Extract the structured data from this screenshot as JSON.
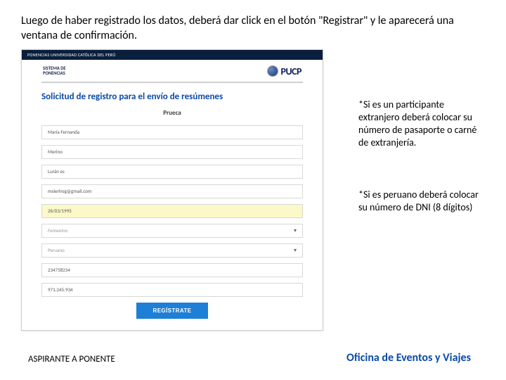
{
  "instruction": "Luego de haber registrado los datos, deberá dar click en el botón \"Registrar\" y le aparecerá una ventana de confirmación.",
  "browser_top": "PONENCIAS UNIVERSIDAD CATÓLICA DEL PERÚ",
  "app_header": {
    "sistema_line1": "SISTEMA DE",
    "sistema_line2": "PONENCIAS",
    "pucp": "PUCP"
  },
  "form": {
    "title": "Solicitud de registro para el envío de resúmenes",
    "subtitle": "Prueca",
    "fields": [
      {
        "text": "María Fernanda",
        "kind": "value",
        "highlight": false,
        "dropdown": false
      },
      {
        "text": "Merino",
        "kind": "value",
        "highlight": false,
        "dropdown": false
      },
      {
        "text": "Lurán es",
        "kind": "value",
        "highlight": false,
        "dropdown": false
      },
      {
        "text": "msierlrog@gmail.com",
        "kind": "value",
        "highlight": false,
        "dropdown": false
      },
      {
        "text": "26/03/1995",
        "kind": "value",
        "highlight": true,
        "dropdown": false
      },
      {
        "text": "Femenino",
        "kind": "placeholder",
        "highlight": false,
        "dropdown": true
      },
      {
        "text": "Peruano",
        "kind": "placeholder",
        "highlight": false,
        "dropdown": true
      },
      {
        "text": "234758234",
        "kind": "value",
        "highlight": false,
        "dropdown": false
      },
      {
        "text": "971.245.934",
        "kind": "value",
        "highlight": false,
        "dropdown": false
      }
    ],
    "submit_label": "REGÍSTRATE"
  },
  "notes": {
    "n1": "*Si es un participante extranjero deberá colocar su número de pasaporte o carné de extranjería.",
    "n2": "*Si es peruano deberá colocar su número de DNI (8 dígitos)"
  },
  "footer": {
    "left": "ASPIRANTE A PONENTE",
    "right": "Oficina de Eventos y Viajes"
  }
}
